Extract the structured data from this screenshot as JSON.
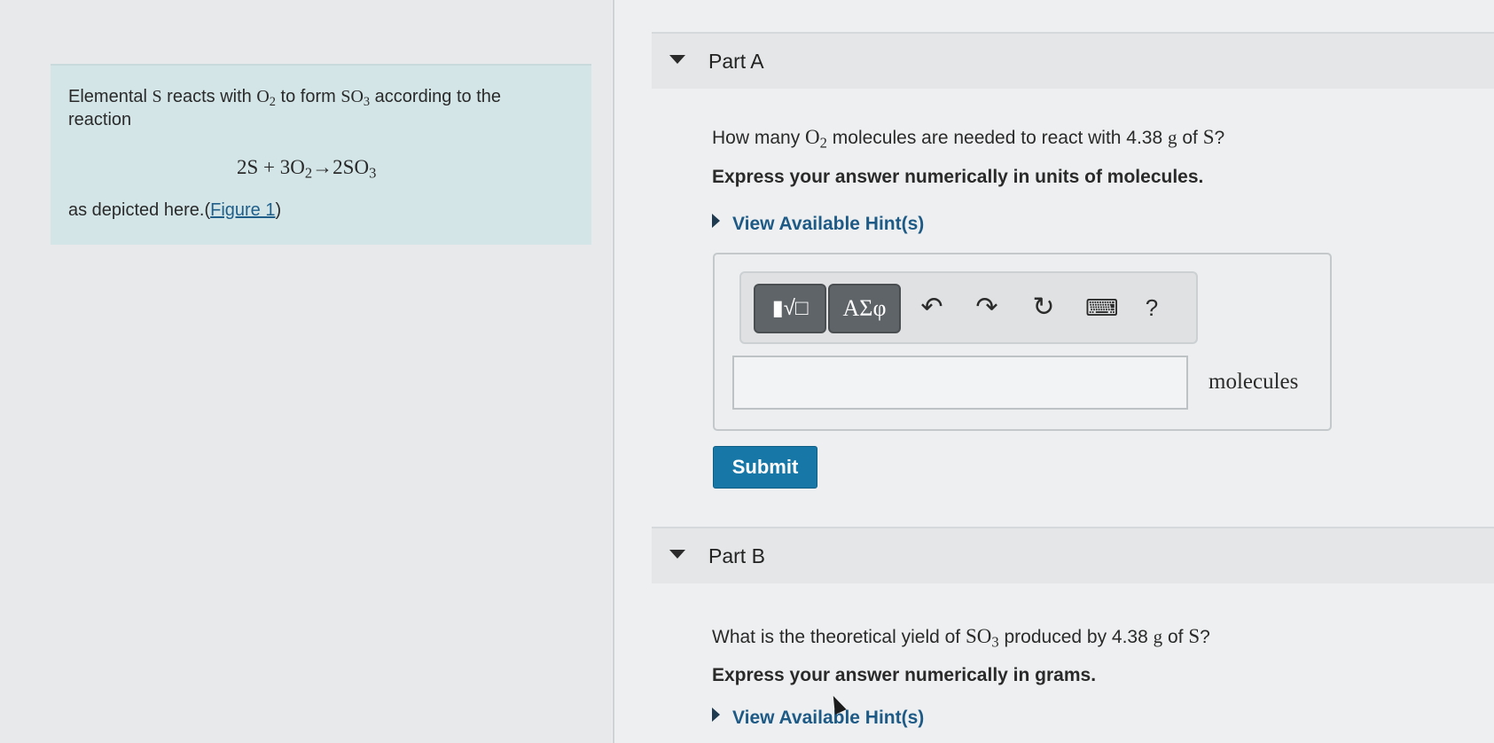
{
  "problem": {
    "line1_prefix": "Elemental ",
    "element_s": "S",
    "line1_mid1": " reacts with ",
    "o2_main": "O",
    "o2_sub": "2",
    "line1_mid2": " to form ",
    "so3_main": "SO",
    "so3_sub": "3",
    "line1_suffix": " according to the",
    "line2": "reaction",
    "equation": {
      "part1": "2S + 3O",
      "sub1": "2",
      "part2": "→2SO",
      "sub2": "3"
    },
    "depicted_prefix": "as depicted here.",
    "figure_open": "(",
    "figure_link": "Figure 1",
    "figure_close": ")"
  },
  "part_a": {
    "title": "Part A",
    "q_prefix": "How many ",
    "q_o": "O",
    "q_o_sub": "2",
    "q_mid": " molecules are needed to react with 4.38 ",
    "q_unit": "g",
    "q_of": " of ",
    "q_s": "S",
    "q_end": "?",
    "instruction": "Express your answer numerically in units of molecules.",
    "hint_label": "View Available Hint(s)",
    "toolbar": {
      "templates_label": "▮√□",
      "greek_label": "ΑΣφ",
      "undo_icon": "↶",
      "redo_icon": "↷",
      "reset_icon": "↻",
      "keyboard_icon": "⌨",
      "help_label": "?"
    },
    "input_value": "",
    "unit": "molecules",
    "submit_label": "Submit"
  },
  "part_b": {
    "title": "Part B",
    "q_prefix": "What is the theoretical yield of ",
    "q_so": "SO",
    "q_so_sub": "3",
    "q_mid": " produced by 4.38 ",
    "q_unit": "g",
    "q_of": " of ",
    "q_s": "S",
    "q_end": "?",
    "instruction": "Express your answer numerically in grams.",
    "hint_label": "View Available Hint(s)"
  }
}
